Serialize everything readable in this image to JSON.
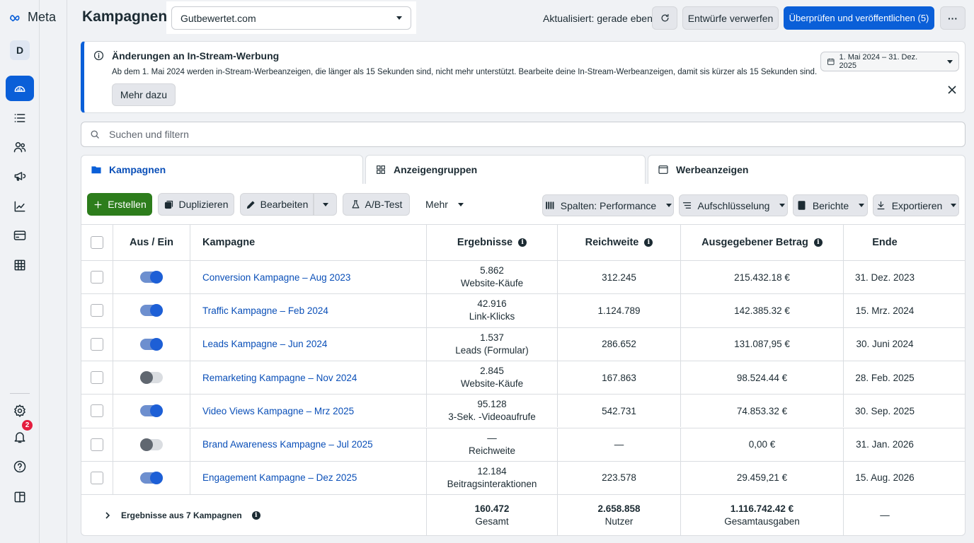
{
  "brand": {
    "name": "Meta",
    "avatar_letter": "D",
    "notification_count": "2"
  },
  "header": {
    "title": "Kampagnen",
    "account": "Gutbewertet.com",
    "updated": "Aktualisiert: gerade eben",
    "discard_label": "Entwürfe verwerfen",
    "publish_label": "Überprüfen und veröffentlichen (5)",
    "more_label": "···"
  },
  "banner": {
    "title": "Änderungen an In-Stream-Werbung",
    "text": "Ab dem 1. Mai 2024 werden in-Stream-Werbeanzeigen, die länger als 15 Sekunden sind, nicht mehr unterstützt. Bearbeite deine In-Stream-Werbeanzeigen, damit sis kürzer als 15 Sekunden sind.",
    "button": "Mehr dazu",
    "date_range": "1. Mai 2024 – 31. Dez. 2025"
  },
  "search": {
    "placeholder": "Suchen und filtern"
  },
  "tabs": [
    {
      "label": "Kampagnen"
    },
    {
      "label": "Anzeigengruppen"
    },
    {
      "label": "Werbeanzeigen"
    }
  ],
  "toolbar": {
    "create": "Erstellen",
    "duplicate": "Duplizieren",
    "edit": "Bearbeiten",
    "abtest": "A/B-Test",
    "more": "Mehr",
    "columns": "Spalten: Performance",
    "breakdown": "Aufschlüsselung",
    "reports": "Berichte",
    "export": "Exportieren"
  },
  "table": {
    "headers": {
      "toggle": "Aus / Ein",
      "campaign": "Kampagne",
      "results": "Ergebnisse",
      "reach": "Reichweite",
      "spent": "Ausgegebener Betrag",
      "end": "Ende"
    },
    "rows": [
      {
        "name": "Conversion Kampagne – Aug 2023",
        "on": true,
        "result": "5.862",
        "result_type": "Website-Käufe",
        "reach": "312.245",
        "spent": "215.432.18 €",
        "end": "31. Dez. 2023"
      },
      {
        "name": "Traffic Kampagne – Feb 2024",
        "on": true,
        "result": "42.916",
        "result_type": "Link-Klicks",
        "reach": "1.124.789",
        "spent": "142.385.32 €",
        "end": "15. Mrz. 2024"
      },
      {
        "name": "Leads Kampagne – Jun 2024",
        "on": true,
        "result": "1.537",
        "result_type": "Leads (Formular)",
        "reach": "286.652",
        "spent": "131.087,95 €",
        "end": "30. Juni 2024"
      },
      {
        "name": "Remarketing Kampagne – Nov 2024",
        "on": false,
        "result": "2.845",
        "result_type": "Website-Käufe",
        "reach": "167.863",
        "spent": "98.524.44 €",
        "end": "28. Feb. 2025"
      },
      {
        "name": "Video Views Kampagne – Mrz 2025",
        "on": true,
        "result": "95.128",
        "result_type": "3-Sek. -Videoaufrufe",
        "reach": "542.731",
        "spent": "74.853.32 €",
        "end": "30. Sep. 2025"
      },
      {
        "name": "Brand Awareness Kampagne – Jul 2025",
        "on": false,
        "result": "—",
        "result_type": "Reichweite",
        "reach": "—",
        "spent": "0,00 €",
        "end": "31. Jan. 2026"
      },
      {
        "name": "Engagement Kampagne – Dez 2025",
        "on": true,
        "result": "12.184",
        "result_type": "Beitragsinteraktionen",
        "reach": "223.578",
        "spent": "29.459,21 €",
        "end": "15. Aug. 2026"
      }
    ],
    "summary": {
      "label": "Ergebnisse aus 7 Kampagnen",
      "results": "160.472",
      "results_sub": "Gesamt",
      "reach": "2.658.858",
      "reach_sub": "Nutzer",
      "spent": "1.116.742.42 €",
      "spent_sub": "Gesamtausgaben",
      "end": "—"
    }
  }
}
